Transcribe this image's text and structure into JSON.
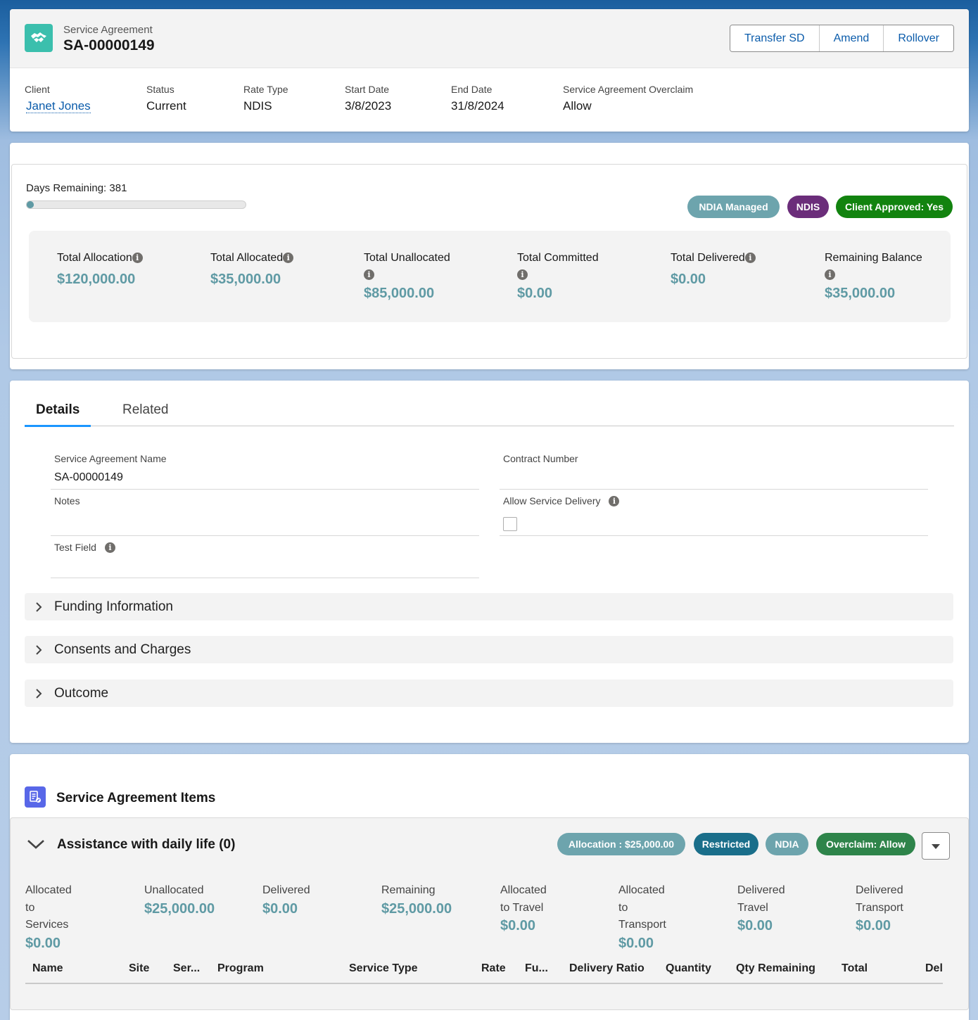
{
  "header": {
    "object_type": "Service Agreement",
    "record_name": "SA-00000149",
    "icon": "handshake-icon",
    "buttons": [
      "Transfer SD",
      "Amend",
      "Rollover"
    ],
    "fields": [
      {
        "label": "Client",
        "value": "Janet Jones"
      },
      {
        "label": "Status",
        "value": "Current"
      },
      {
        "label": "Rate Type",
        "value": "NDIS"
      },
      {
        "label": "Start Date",
        "value": "3/8/2023"
      },
      {
        "label": "End Date",
        "value": "31/8/2024"
      },
      {
        "label": "Service Agreement Overclaim",
        "value": "Allow"
      }
    ]
  },
  "balance": {
    "days_remaining_label": "Days Remaining: 381",
    "days_progress_fraction": 0.02,
    "badges": [
      {
        "label": "NDIA Managed",
        "color": "#6da4ad"
      },
      {
        "label": "NDIS",
        "color": "#6b2d7a"
      },
      {
        "label": "Client Approved: Yes",
        "color": "#12830f"
      }
    ],
    "stats": [
      {
        "label": "Total Allocation",
        "value": "$120,000.00"
      },
      {
        "label": "Total Allocated",
        "value": "$35,000.00"
      },
      {
        "label": "Total Unallocated",
        "value": "$85,000.00"
      },
      {
        "label": "Total Committed",
        "value": "$0.00"
      },
      {
        "label": "Total Delivered",
        "value": "$0.00"
      },
      {
        "label": "Remaining Balance",
        "value": "$35,000.00"
      }
    ]
  },
  "details": {
    "tabs": [
      "Details",
      "Related"
    ],
    "active_tab": "Details",
    "fields": {
      "sa_name": {
        "label": "Service Agreement Name",
        "value": "SA-00000149"
      },
      "contract_number": {
        "label": "Contract Number",
        "value": ""
      },
      "notes": {
        "label": "Notes",
        "value": ""
      },
      "allow_service_delivery": {
        "label": "Allow Service Delivery",
        "checked": false
      },
      "test_field": {
        "label": "Test Field",
        "value": ""
      }
    },
    "sections": [
      "Funding Information",
      "Consents and Charges",
      "Outcome"
    ]
  },
  "items": {
    "title": "Service Agreement Items",
    "group": {
      "title": "Assistance with daily life (0)",
      "badges": [
        {
          "label": "Allocation : $25,000.00",
          "color": "#6da4ad"
        },
        {
          "label": "Restricted",
          "color": "#1a6e8a"
        },
        {
          "label": "NDIA",
          "color": "#6da4ad"
        },
        {
          "label": "Overclaim: Allow",
          "color": "#2e844a"
        }
      ],
      "stats": [
        {
          "label": "Allocated\nto\nServices",
          "value": "$0.00"
        },
        {
          "label": "Unallocated",
          "value": "$25,000.00"
        },
        {
          "label": "Delivered",
          "value": "$0.00"
        },
        {
          "label": "Remaining",
          "value": "$25,000.00"
        },
        {
          "label": "Allocated\nto Travel",
          "value": "$0.00"
        },
        {
          "label": "Allocated\nto\nTransport",
          "value": "$0.00"
        },
        {
          "label": "Delivered\nTravel",
          "value": "$0.00"
        },
        {
          "label": "Delivered\nTransport",
          "value": "$0.00"
        }
      ],
      "columns": [
        "Name",
        "Site",
        "Ser...",
        "Program",
        "Service Type",
        "Rate",
        "Fu...",
        "Delivery Ratio",
        "Quantity",
        "Qty Remaining",
        "Total",
        "Del"
      ]
    }
  }
}
